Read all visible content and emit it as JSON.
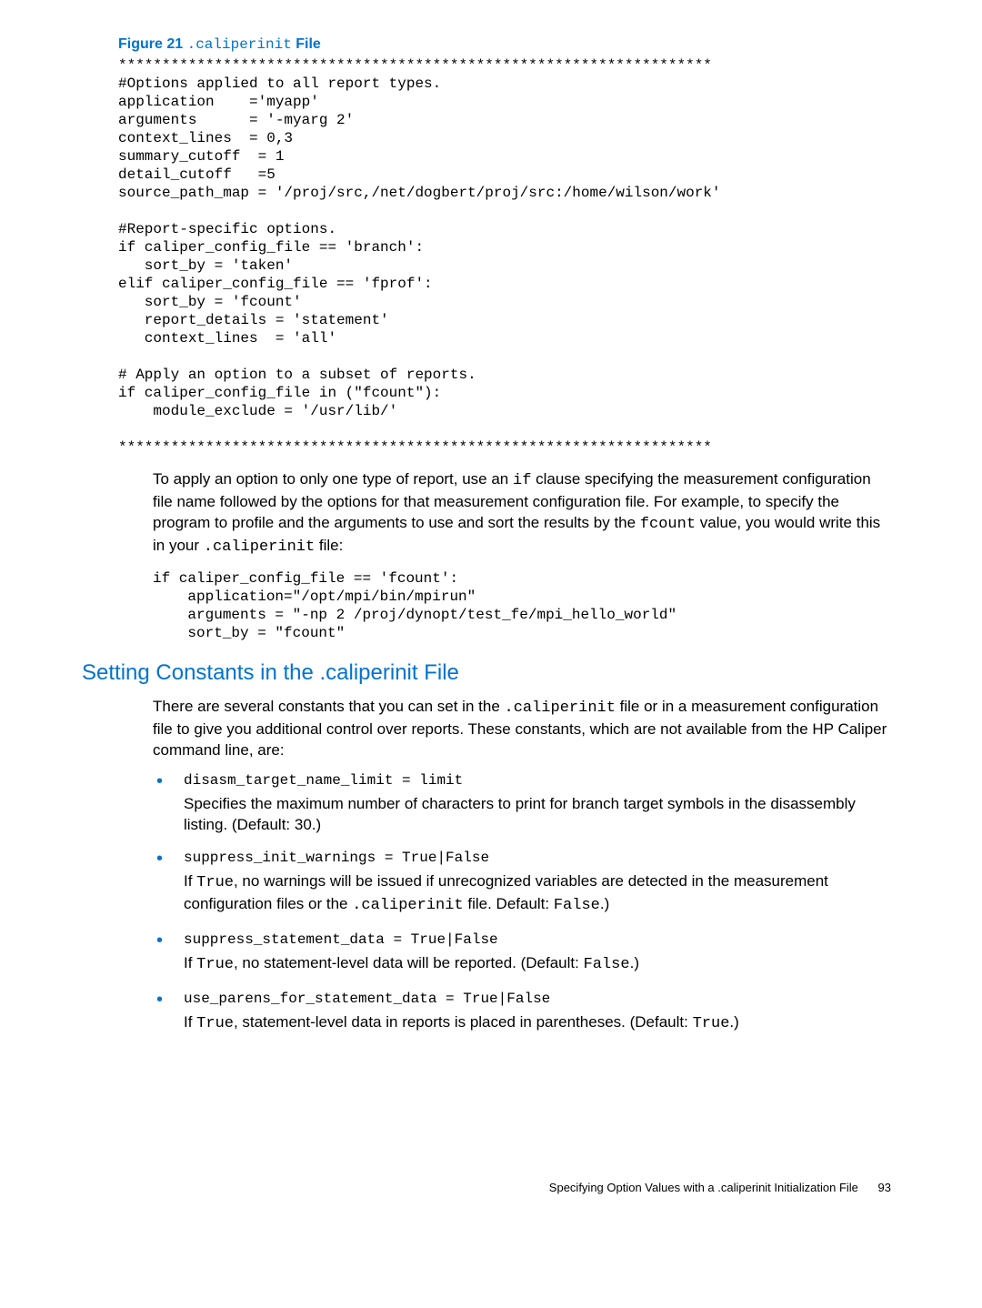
{
  "figure": {
    "label_prefix": "Figure 21",
    "label_code": ".caliperinit",
    "label_suffix": "File"
  },
  "code1": "********************************************************************\n#Options applied to all report types.\napplication    ='myapp'\narguments      = '-myarg 2'\ncontext_lines  = 0,3\nsummary_cutoff  = 1\ndetail_cutoff   =5\nsource_path_map = '/proj/src,/net/dogbert/proj/src:/home/wilson/work'\n\n#Report-specific options.\nif caliper_config_file == 'branch':\n   sort_by = 'taken'\nelif caliper_config_file == 'fprof':\n   sort_by = 'fcount'\n   report_details = 'statement'\n   context_lines  = 'all'\n\n# Apply an option to a subset of reports.\nif caliper_config_file in (\"fcount\"):\n    module_exclude = '/usr/lib/'\n\n********************************************************************",
  "para1": {
    "t1": "To apply an option to only one type of report, use an ",
    "c1": "if",
    "t2": " clause specifying the measurement configuration file name followed by the options for that measurement configuration file. For example, to specify the program to profile and the arguments to use and sort the results by the ",
    "c2": "fcount",
    "t3": " value, you would write this in your ",
    "c3": ".caliperinit",
    "t4": " file:"
  },
  "code2": "if caliper_config_file == 'fcount':\n    application=\"/opt/mpi/bin/mpirun\"\n    arguments = \"-np 2 /proj/dynopt/test_fe/mpi_hello_world\"\n    sort_by = \"fcount\"",
  "section_heading": "Setting Constants in the .caliperinit File",
  "para2": {
    "t1": "There are several constants that you can set in the ",
    "c1": ".caliperinit",
    "t2": " file or in a measurement configuration file to give you additional control over reports. These constants, which are not available from the HP Caliper command line, are:"
  },
  "bullets": [
    {
      "code": "disasm_target_name_limit = limit",
      "desc_parts": [
        {
          "t": "Specifies the maximum number of characters to print for branch target symbols in the disassembly listing. (Default: 30.)"
        }
      ]
    },
    {
      "code": "suppress_init_warnings = True|False",
      "desc_parts": [
        {
          "t": "If "
        },
        {
          "c": "True"
        },
        {
          "t": ", no warnings will be issued if unrecognized variables are detected in the measurement configuration files or the "
        },
        {
          "c": ".caliperinit"
        },
        {
          "t": " file. Default: "
        },
        {
          "c": "False"
        },
        {
          "t": ".)"
        }
      ]
    },
    {
      "code": "suppress_statement_data = True|False",
      "desc_parts": [
        {
          "t": "If "
        },
        {
          "c": "True"
        },
        {
          "t": ", no statement-level data will be reported. (Default: "
        },
        {
          "c": "False"
        },
        {
          "t": ".)"
        }
      ]
    },
    {
      "code": "use_parens_for_statement_data = True|False",
      "desc_parts": [
        {
          "t": "If "
        },
        {
          "c": "True"
        },
        {
          "t": ", statement-level data in reports is placed in parentheses. (Default: "
        },
        {
          "c": "True"
        },
        {
          "t": ".)"
        }
      ]
    }
  ],
  "footer": {
    "text": "Specifying Option Values with a .caliperinit Initialization File",
    "page": "93"
  }
}
